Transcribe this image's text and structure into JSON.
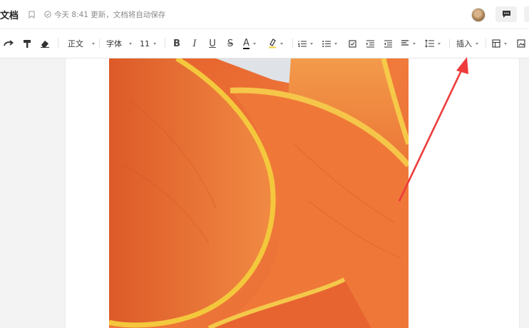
{
  "titlebar": {
    "doc_title": "文档",
    "save_status": "今天 8:41 更新，文档将自动保存"
  },
  "toolbar": {
    "style_select": "正文",
    "font_select": "字体",
    "size_select": "11",
    "bold": "B",
    "italic": "I",
    "underline": "U",
    "strike": "S",
    "font_color": "A",
    "insert": "插入"
  },
  "colors": {
    "accent_arrow": "#ee3b3b",
    "petal_orange": "#e9692f",
    "petal_yellow": "#f4c23e"
  },
  "icons": [
    "redo-icon",
    "format-painter-icon",
    "clear-format-icon",
    "bookmark-icon",
    "check-circle-icon",
    "comment-icon",
    "ordered-list-icon",
    "bullet-list-icon",
    "checkbox-list-icon",
    "indent-icon",
    "outdent-icon",
    "align-icon",
    "line-spacing-icon",
    "table-icon",
    "image-icon"
  ]
}
